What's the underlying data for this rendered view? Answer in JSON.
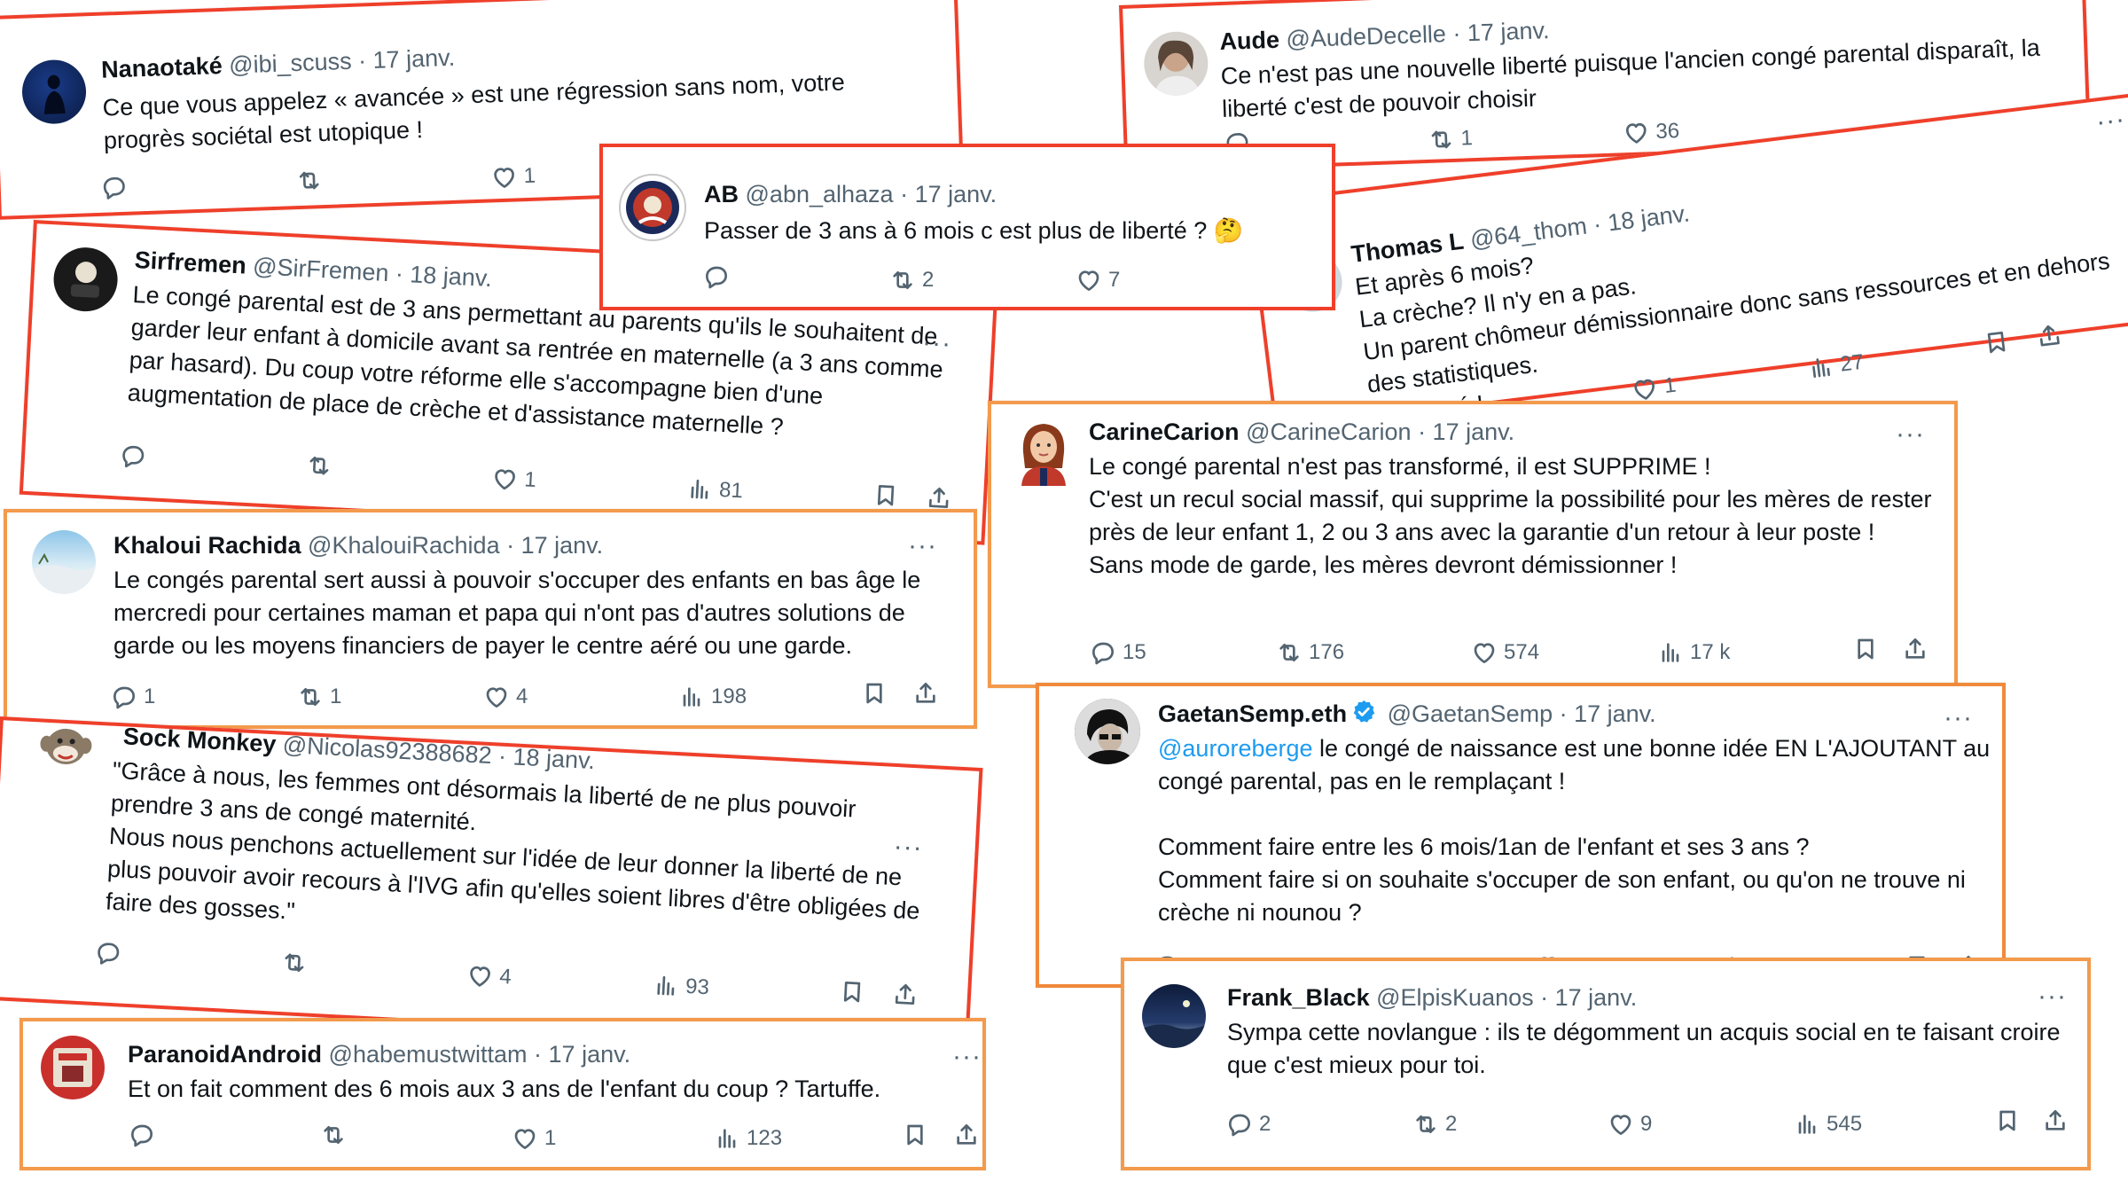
{
  "colors": {
    "border_red": "#ef4a2b",
    "border_orange": "#f39a4c",
    "mention": "#1d9bf0",
    "muted": "#536471"
  },
  "tweets": [
    {
      "name": "Nanaotaké",
      "handle": "@ibi_scuss",
      "date": "· 17 janv.",
      "body": "Ce que vous appelez « avancée » est une régression sans nom, votre progrès sociétal est utopique !",
      "reply": "",
      "retweet": "",
      "like": "1",
      "views": ""
    },
    {
      "name": "Aude",
      "handle": "@AudeDecelle",
      "date": "· 17 janv.",
      "body": "Ce n'est pas une nouvelle liberté puisque l'ancien congé parental disparaît, la liberté c'est de pouvoir choisir",
      "reply": "",
      "retweet": "1",
      "like": "36",
      "views": ""
    },
    {
      "name": "AB",
      "handle": "@abn_alhaza",
      "date": "· 17 janv.",
      "body": "Passer de 3 ans à 6 mois c est plus de liberté ? 🤔",
      "reply": "",
      "retweet": "2",
      "like": "7",
      "views": ""
    },
    {
      "name": "Thomas L",
      "handle": "@64_thom",
      "date": "· 18 janv.",
      "body": "Et après 6 mois?\nLa crèche? Il n'y en a pas.\nUn parent chômeur démissionnaire donc sans ressources et en dehors des statistiques.\nBien joué !",
      "reply": "",
      "retweet": "",
      "like": "1",
      "views": "27"
    },
    {
      "name": "Sirfremen",
      "handle": "@SirFremen",
      "date": "· 18 janv.",
      "body": "Le congé parental est de 3 ans permettant au parents qu'ils le souhaitent de garder leur enfant à domicile avant sa rentrée en maternelle (a 3 ans comme par hasard). Du coup votre réforme elle s'accompagne bien d'une augmentation de place de crèche et d'assistance maternelle ?",
      "reply": "",
      "retweet": "",
      "like": "1",
      "views": "81"
    },
    {
      "name": "CarineCarion",
      "handle": "@CarineCarion",
      "date": "· 17 janv.",
      "body": "Le congé parental n'est pas transformé, il est SUPPRIME !\nC'est un recul social massif, qui supprime la possibilité pour les mères de rester près de leur enfant 1, 2 ou 3 ans avec la garantie d'un retour à leur poste !\nSans mode de garde, les mères devront démissionner !",
      "reply": "15",
      "retweet": "176",
      "like": "574",
      "views": "17 k"
    },
    {
      "name": "Khaloui Rachida",
      "handle": "@KhalouiRachida",
      "date": "· 17 janv.",
      "body": "Le congés parental sert aussi à pouvoir s'occuper des enfants en bas âge le mercredi pour certaines maman et papa qui n'ont pas d'autres solutions de garde ou les moyens financiers de payer le centre aéré ou  une garde.",
      "reply": "1",
      "retweet": "1",
      "like": "4",
      "views": "198"
    },
    {
      "name": "GaetanSemp.eth",
      "handle": "@GaetanSemp",
      "date": "· 17 janv.",
      "mention": "@auroreberge",
      "body": " le congé de naissance est une bonne idée EN L'AJOUTANT au congé parental, pas en le remplaçant !\n\nComment faire entre les 6 mois/1an de l'enfant et ses 3 ans ?\nComment faire si on souhaite s'occuper de son enfant, ou qu'on ne trouve ni crèche ni nounou ?",
      "reply": "",
      "retweet": "",
      "like": "",
      "views": ""
    },
    {
      "name": "Sock Monkey",
      "handle": "@Nicolas92388682",
      "date": "· 18 janv.",
      "body": "\"Grâce à nous, les femmes ont désormais la liberté de ne plus pouvoir prendre 3 ans de congé maternité.\nNous nous penchons actuellement sur l'idée de leur donner la liberté de ne plus pouvoir avoir recours à l'IVG afin qu'elles soient libres d'être obligées de faire des gosses.\"",
      "reply": "",
      "retweet": "",
      "like": "4",
      "views": "93"
    },
    {
      "name": "Frank_Black",
      "handle": "@ElpisKuanos",
      "date": "· 17 janv.",
      "body": "Sympa cette novlangue : ils te dégomment un acquis social en te faisant croire que c'est mieux pour toi.",
      "reply": "2",
      "retweet": "2",
      "like": "9",
      "views": "545"
    },
    {
      "name": "ParanoidAndroid",
      "handle": "@habemustwittam",
      "date": "· 17 janv.",
      "body": "Et on fait comment des 6 mois aux 3 ans de l'enfant du coup ? Tartuffe.",
      "reply": "",
      "retweet": "",
      "like": "1",
      "views": "123"
    }
  ]
}
